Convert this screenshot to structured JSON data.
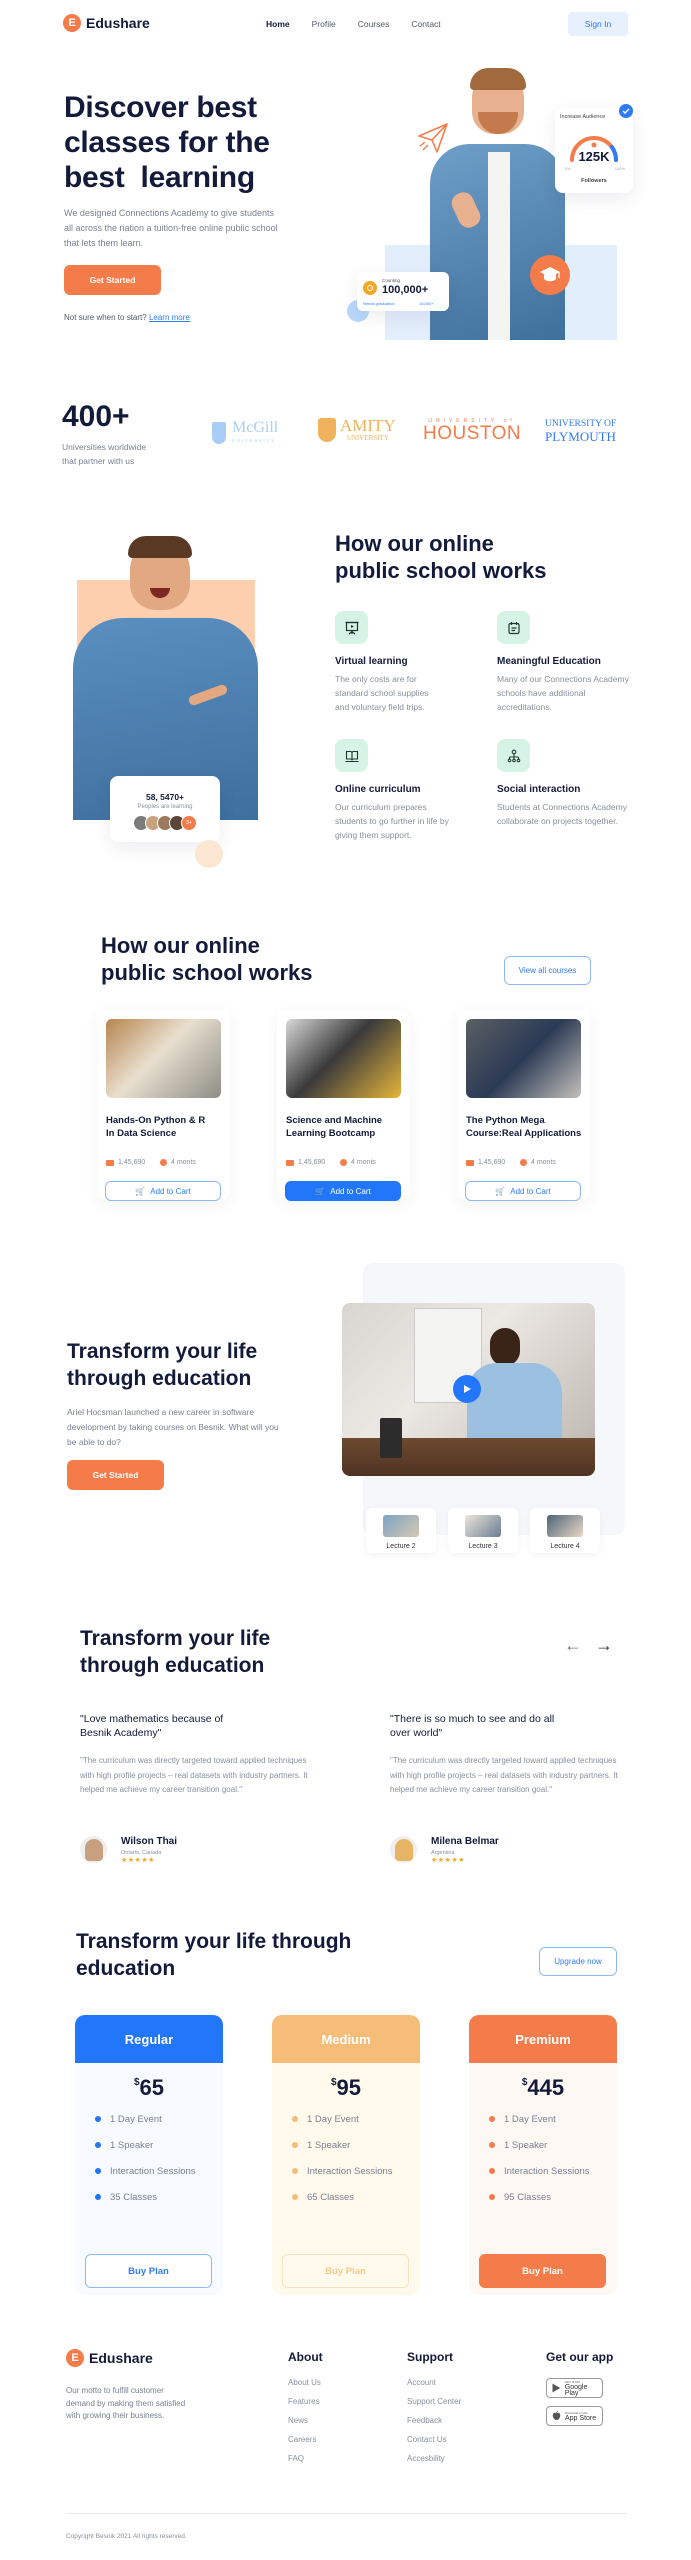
{
  "header": {
    "brand": "Edushare",
    "brand_initial": "E",
    "nav": [
      {
        "label": "Home",
        "active": true
      },
      {
        "label": "Profile",
        "active": false
      },
      {
        "label": "Courses",
        "active": false
      },
      {
        "label": "Contact",
        "active": false
      }
    ],
    "signin_label": "Sign In"
  },
  "hero": {
    "title_line1": "Discover best",
    "title_line2": "classes for the",
    "title_line3": "best  learning",
    "description": "We designed Connections Academy to give students all across the nation a tuition-free online public school that lets them learn.",
    "cta_label": "Get Started",
    "help_text": "Not sure when to start?",
    "help_link": "Learn more",
    "audience_card": {
      "title": "Increase Audience",
      "value": "125K",
      "label": "Followers",
      "min_label": "0%",
      "max_label": "100%",
      "progress": 0.8
    },
    "counting_card": {
      "label": "Counting",
      "value": "100,000+",
      "sub_left": "Needs graduation",
      "sub_right": "15,000+"
    }
  },
  "partners": {
    "count": "400+",
    "caption_line1": "Universities worldwide",
    "caption_line2": "that partner with us",
    "logos": [
      {
        "name": "McGill",
        "sub": "UNIVERSITY",
        "color": "#a9cdf5"
      },
      {
        "name": "AMITY",
        "sub": "UNIVERSITY",
        "color": "#f0b25c"
      },
      {
        "name": "HOUSTON",
        "sub": "UNIVERSITY of",
        "color": "#f47c4a"
      },
      {
        "name": "PLYMOUTH",
        "sub": "UNIVERSITY OF",
        "color": "#2f7bf5"
      }
    ]
  },
  "how_it_works": {
    "title_line1": "How our online",
    "title_line2": "public school works",
    "learners_card": {
      "value": "58, 5470+",
      "label": "Peoples are learning",
      "more": "3+"
    },
    "features": [
      {
        "icon": "presentation-icon",
        "title": "Virtual learning",
        "desc": "The only costs are for standard school supplies and voluntary field trips."
      },
      {
        "icon": "notepad-icon",
        "title": "Meaningful Education",
        "desc": "Many of our Connections Academy schools have additional accreditations."
      },
      {
        "icon": "book-icon",
        "title": "Online curriculum",
        "desc": "Our curriculum prepares students to go further in life by giving them support."
      },
      {
        "icon": "network-icon",
        "title": "Social interaction",
        "desc": "Students at Connections Academy collaborate on projects together."
      }
    ]
  },
  "courses": {
    "title_line1": "How our online",
    "title_line2": "public school works",
    "view_all_label": "View all courses",
    "items": [
      {
        "title_line1": "Hands-On Python & R",
        "title_line2": "In Data Science",
        "students": "1,45,690",
        "duration": "4 monts",
        "cart_label": "Add to Cart",
        "primary": false
      },
      {
        "title_line1": "Science and Machine",
        "title_line2": "Learning Bootcamp",
        "students": "1,45,690",
        "duration": "4 monts",
        "cart_label": "Add to Cart",
        "primary": true
      },
      {
        "title_line1": "The Python Mega",
        "title_line2": "Course:Real Applications",
        "students": "1,45,690",
        "duration": "4 monts",
        "cart_label": "Add to Cart",
        "primary": false
      }
    ]
  },
  "video_section": {
    "title_line1": "Transform your life",
    "title_line2": "through education",
    "description": "Ariel Hocsman launched a new career in software development by taking courses on Besnik. What will you be able to do?",
    "cta_label": "Get Started",
    "lectures": [
      {
        "label": "Lecture 2"
      },
      {
        "label": "Lecture 3"
      },
      {
        "label": "Lecture 4"
      }
    ]
  },
  "testimonials": {
    "title_line1": "Transform your life",
    "title_line2": "through education",
    "items": [
      {
        "quote_line1": "\"Love mathematics because of",
        "quote_line2": "Besnik Academy\"",
        "body": "\"The curriculum was directly targeted toward applied techniques with high profile projects – real datasets with industry partners. It helped me achieve my career transition goal.\"",
        "name": "Wilson Thai",
        "location": "Ontario, Canada",
        "stars": "★★★★★",
        "rating": 5
      },
      {
        "quote_line1": "\"There is so much to see and do all",
        "quote_line2": "over world\"",
        "body": "\"The curriculum was directly targeted toward applied techniques with high profile projects – real datasets with industry partners. It helped me achieve my career transition goal.\"",
        "name": "Milena Belmar",
        "location": "Argentina",
        "stars": "★★★★★",
        "rating": 5
      }
    ]
  },
  "pricing": {
    "title_line1": "Transform your life through",
    "title_line2": "education",
    "upgrade_label": "Upgrade now",
    "currency": "$",
    "plans": [
      {
        "name": "Regular",
        "price": "65",
        "color": "#2176fa",
        "features": [
          "1 Day Event",
          "1 Speaker",
          "Interaction Sessions",
          "35 Classes"
        ],
        "buy_label": "Buy Plan"
      },
      {
        "name": "Medium",
        "price": "95",
        "color": "#f5bd78",
        "features": [
          "1 Day Event",
          "1 Speaker",
          "Interaction Sessions",
          "65 Classes"
        ],
        "buy_label": "Buy Plan"
      },
      {
        "name": "Premium",
        "price": "445",
        "color": "#f47c4a",
        "features": [
          "1 Day Event",
          "1 Speaker",
          "Interaction Sessions",
          "95 Classes"
        ],
        "buy_label": "Buy Plan"
      }
    ]
  },
  "footer": {
    "brand": "Edushare",
    "brand_initial": "E",
    "motto": "Our motto to fulfill customer demand by making them satisfied with growing their business.",
    "about": {
      "title": "About",
      "links": [
        "About Us",
        "Features",
        "News",
        "Careers",
        "FAQ"
      ]
    },
    "support": {
      "title": "Support",
      "links": [
        "Account",
        "Support Center",
        "Feedback",
        "Contact Us",
        "Accesbility"
      ]
    },
    "app": {
      "title": "Get our app",
      "google_small": "GET IT ON",
      "google_big": "Google Play",
      "apple_small": "Download on the",
      "apple_big": "App Store"
    },
    "copyright": "Copyright Besnik 2021 All rights reserved."
  },
  "colors": {
    "brand_orange": "#f47c4a",
    "brand_blue": "#2f7bf5",
    "navy": "#141a3a",
    "mint": "#d6f4e5"
  }
}
